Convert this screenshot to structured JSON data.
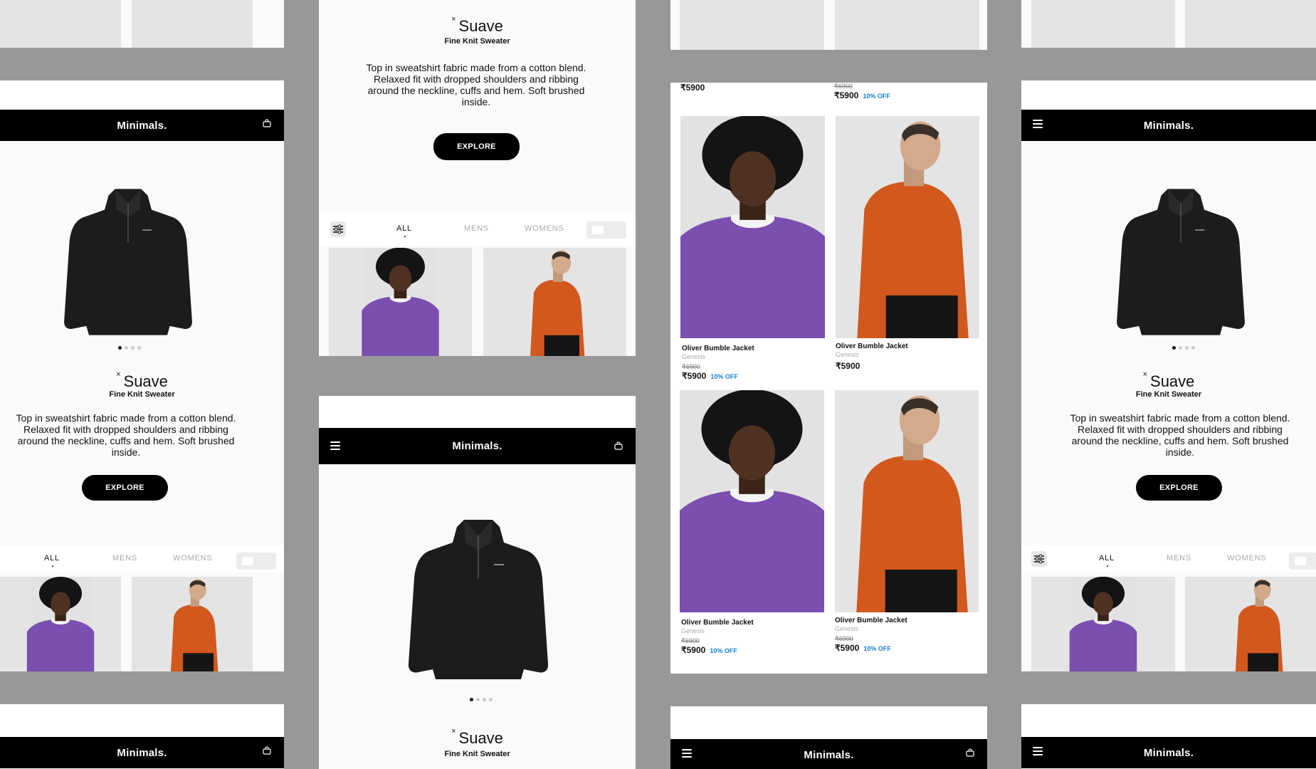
{
  "brand": "Minimals.",
  "product": {
    "mark": "×",
    "name": "Suave",
    "subtitle": "Fine Knit Sweater",
    "description": "Top in sweatshirt fabric made from a cotton blend. Relaxed fit with dropped shoulders and ribbing around the neckline, cuffs and hem. Soft brushed inside.",
    "explore_label": "EXPLORE"
  },
  "tabs": {
    "all": "ALL",
    "mens": "MENS",
    "womens": "WOMENS"
  },
  "cards": [
    {
      "name": "Oliver Bumble Jacket",
      "brand": "Genesis",
      "old_price": "₹6900",
      "price": "₹5900",
      "discount": "10% OFF"
    },
    {
      "name": "Oliver Bumble Jacket",
      "brand": "Genesis",
      "price": "₹5900"
    },
    {
      "name": "Oliver Bumble Jacket",
      "brand": "Genesis",
      "old_price": "₹6900",
      "price": "₹5900",
      "discount": "10% OFF"
    },
    {
      "name": "Oliver Bumble Jacket",
      "brand": "Genesis",
      "old_price": "₹6900",
      "price": "₹5900",
      "discount": "10% OFF"
    }
  ],
  "top_prices": {
    "left": "₹5900",
    "right_old": "₹6900",
    "right": "₹5900",
    "right_discount": "10% OFF"
  },
  "colors": {
    "background": "#989898",
    "navbar": "#000000",
    "accent_blue": "#1a7fd6",
    "purple_sweater": "#7a4fb0",
    "orange_sweater": "#d2581e"
  },
  "icons": [
    "bag-icon",
    "menu-icon",
    "filter-icon",
    "toggle-switch"
  ]
}
